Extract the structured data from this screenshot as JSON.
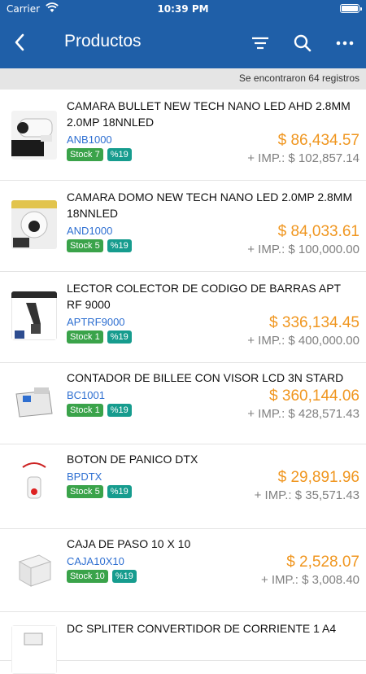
{
  "status": {
    "carrier": "Carrier",
    "time": "10:39 PM"
  },
  "header": {
    "title": "Productos",
    "icons": [
      "back-arrow-icon",
      "filter-icon",
      "search-icon",
      "more-icon"
    ]
  },
  "results_text": "Se encontraron 64 registros",
  "colors": {
    "header": "#1f5fa8",
    "price": "#f0961f",
    "code": "#2e6fd1",
    "stock_badge": "#3aa34a",
    "tax_badge": "#169c8e"
  },
  "products": [
    {
      "name": "CAMARA BULLET NEW TECH NANO LED AHD 2.8MM 2.0MP 18NNLED",
      "code": "ANB1000",
      "stock": "Stock 7",
      "tax": "%19",
      "price": "$ 86,434.57",
      "imp": "+ IMP.: $ 102,857.14",
      "thumb": "bullet-camera-image"
    },
    {
      "name": "CAMARA DOMO NEW TECH NANO LED 2.0MP 2.8MM 18NNLED",
      "code": "AND1000",
      "stock": "Stock 5",
      "tax": "%19",
      "price": "$ 84,033.61",
      "imp": "+ IMP.: $ 100,000.00",
      "thumb": "dome-camera-image"
    },
    {
      "name": "LECTOR COLECTOR DE CODIGO DE BARRAS APT RF 9000",
      "code": "APTRF9000",
      "stock": "Stock 1",
      "tax": "%19",
      "price": "$ 336,134.45",
      "imp": "+ IMP.: $ 400,000.00",
      "thumb": "barcode-scanner-image"
    },
    {
      "name": "CONTADOR DE BILLEE CON VISOR LCD 3N STARD",
      "code": "BC1001",
      "stock": "Stock 1",
      "tax": "%19",
      "price": "$ 360,144.06",
      "imp": "+ IMP.: $ 428,571.43",
      "thumb": "bill-counter-image"
    },
    {
      "name": "BOTON DE PANICO DTX",
      "code": "BPDTX",
      "stock": "Stock 5",
      "tax": "%19",
      "price": "$ 29,891.96",
      "imp": "+ IMP.: $ 35,571.43",
      "thumb": "panic-button-image"
    },
    {
      "name": "CAJA DE PASO 10 X 10",
      "code": "CAJA10X10",
      "stock": "Stock 10",
      "tax": "%19",
      "price": "$ 2,528.07",
      "imp": "+ IMP.: $ 3,008.40",
      "thumb": "junction-box-image"
    },
    {
      "name": "DC SPLITER CONVERTIDOR DE CORRIENTE 1 A4",
      "code": "",
      "stock": "",
      "tax": "",
      "price": "",
      "imp": "",
      "thumb": "dc-splitter-image"
    }
  ]
}
